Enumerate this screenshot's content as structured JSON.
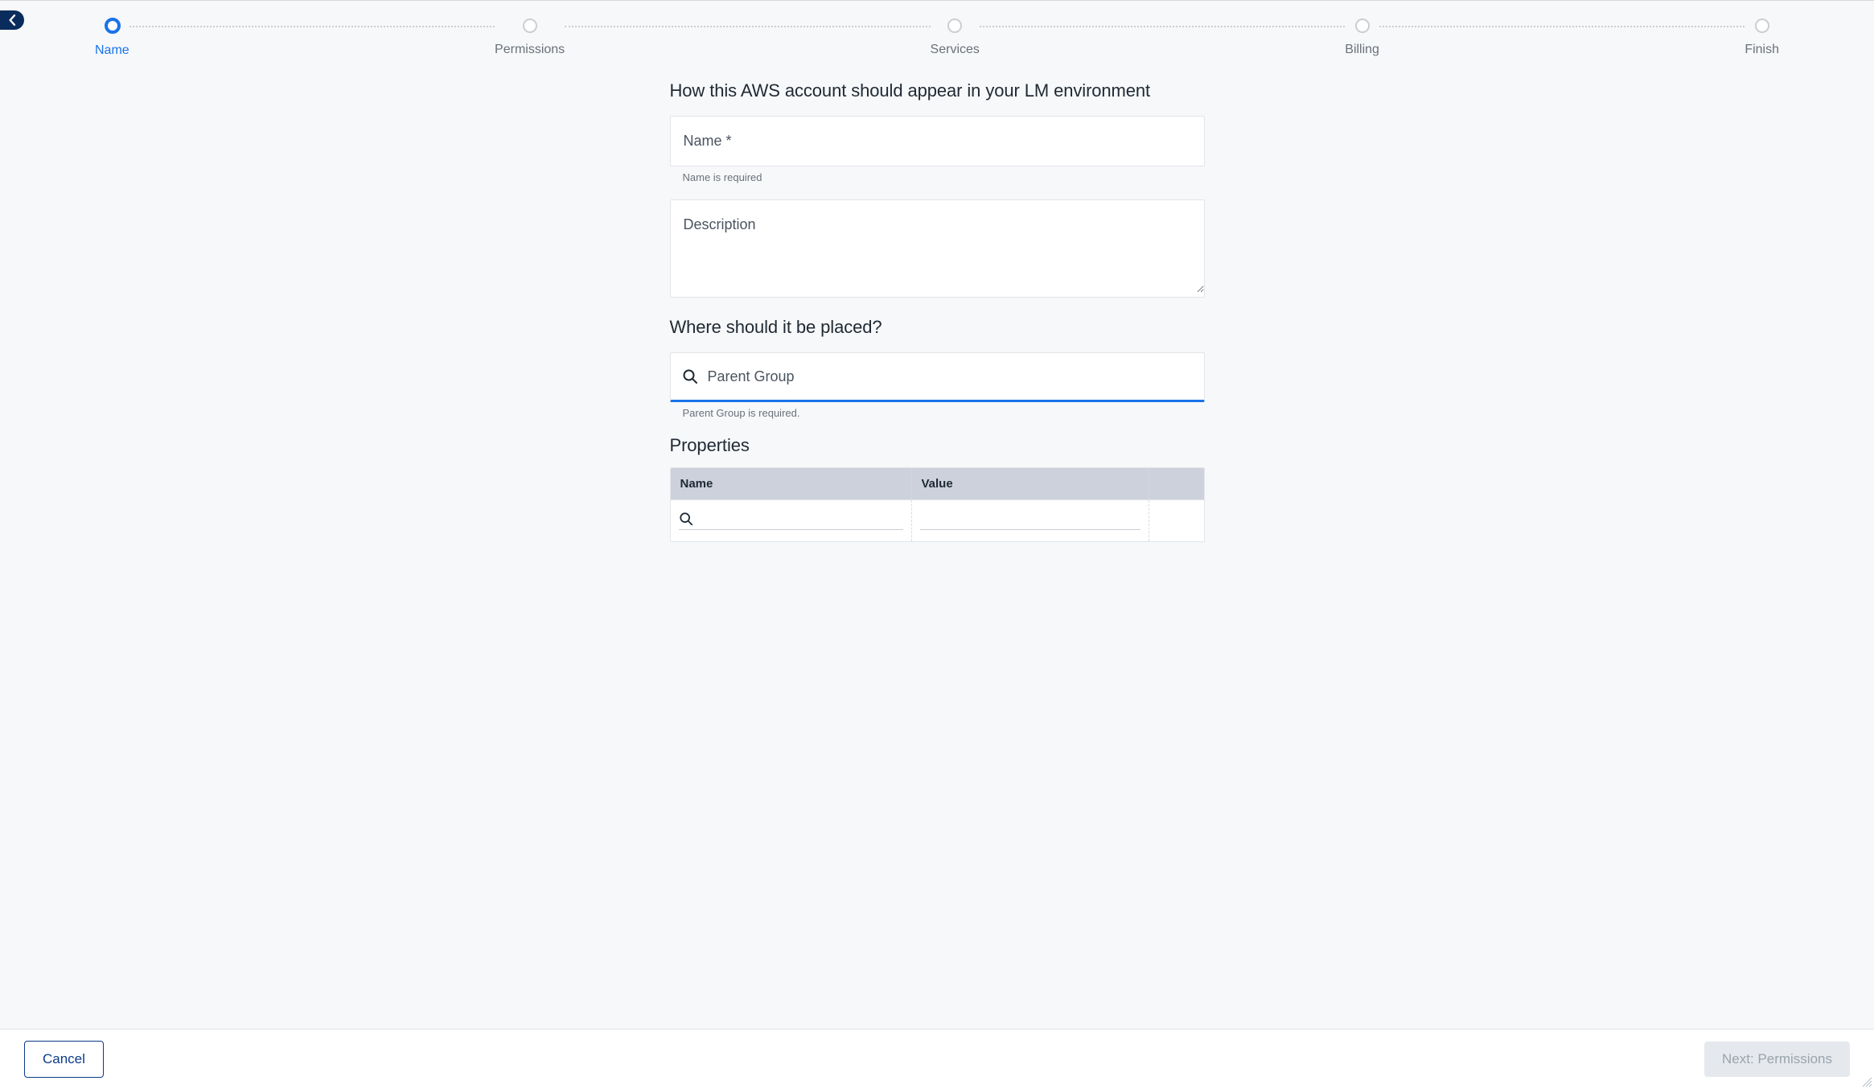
{
  "stepper": {
    "steps": [
      {
        "label": "Name",
        "active": true
      },
      {
        "label": "Permissions",
        "active": false
      },
      {
        "label": "Services",
        "active": false
      },
      {
        "label": "Billing",
        "active": false
      },
      {
        "label": "Finish",
        "active": false
      }
    ]
  },
  "section1": {
    "heading": "How this AWS account should appear in your LM environment",
    "name_placeholder": "Name *",
    "name_value": "",
    "name_helper": "Name is required",
    "description_placeholder": "Description",
    "description_value": ""
  },
  "section2": {
    "heading": "Where should it be placed?",
    "parent_placeholder": "Parent Group",
    "parent_value": "",
    "parent_helper": "Parent Group is required."
  },
  "section3": {
    "heading": "Properties",
    "col_name": "Name",
    "col_value": "Value"
  },
  "footer": {
    "cancel": "Cancel",
    "next": "Next: Permissions"
  }
}
